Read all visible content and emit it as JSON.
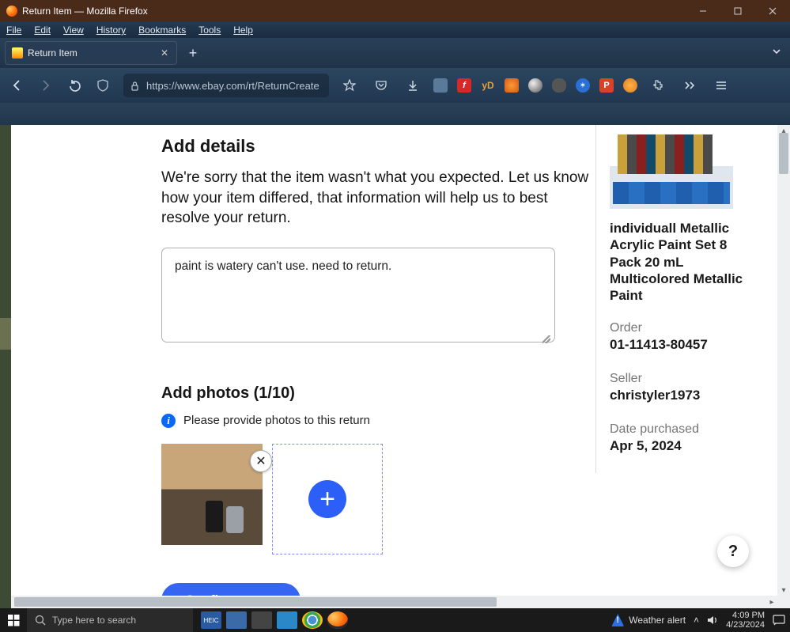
{
  "window": {
    "title": "Return Item — Mozilla Firefox"
  },
  "menu": {
    "file": "File",
    "edit": "Edit",
    "view": "View",
    "history": "History",
    "bookmarks": "Bookmarks",
    "tools": "Tools",
    "help": "Help"
  },
  "tab": {
    "title": "Return Item"
  },
  "address": {
    "url": "https://www.ebay.com/rt/ReturnCreate"
  },
  "page": {
    "add_details_heading": "Add details",
    "sorry_text": "We're sorry that the item wasn't what you expected. Let us know how your item differed, that information will help us to best resolve your return.",
    "details_value": "paint is watery can't use. need to return.",
    "add_photos_heading": "Add photos (1/10)",
    "photos_count_current": 1,
    "photos_count_max": 10,
    "photo_info": "Please provide photos to this return",
    "confirm_label": "Confirm return"
  },
  "order": {
    "product_title": "individuall Metallic Acrylic Paint Set 8 Pack 20 mL Multicolored Metallic Paint",
    "order_label": "Order",
    "order_number": "01-11413-80457",
    "seller_label": "Seller",
    "seller_name": "christyler1973",
    "date_label": "Date purchased",
    "date_value": "Apr 5, 2024"
  },
  "help": {
    "label": "?"
  },
  "taskbar": {
    "search_placeholder": "Type here to search",
    "weather": "Weather alert",
    "time": "4:09 PM",
    "date": "4/23/2024"
  }
}
